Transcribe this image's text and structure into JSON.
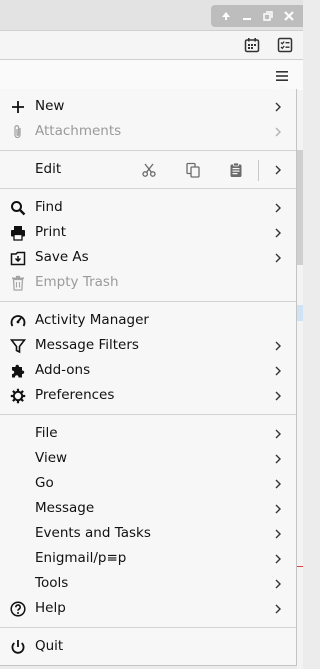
{
  "menu": {
    "items": [
      {
        "label": "New",
        "icon": "plus-icon",
        "submenu": true,
        "disabled": false
      },
      {
        "label": "Attachments",
        "icon": "paperclip-icon",
        "submenu": true,
        "disabled": true
      },
      {
        "label": "Edit",
        "icon": "",
        "submenu": true,
        "disabled": false
      },
      {
        "label": "Find",
        "icon": "magnifier-icon",
        "submenu": true,
        "disabled": false
      },
      {
        "label": "Print",
        "icon": "printer-icon",
        "submenu": true,
        "disabled": false
      },
      {
        "label": "Save As",
        "icon": "save-as-icon",
        "submenu": true,
        "disabled": false
      },
      {
        "label": "Empty Trash",
        "icon": "trash-icon",
        "submenu": false,
        "disabled": true
      },
      {
        "label": "Activity Manager",
        "icon": "gauge-icon",
        "submenu": false,
        "disabled": false
      },
      {
        "label": "Message Filters",
        "icon": "filter-icon",
        "submenu": true,
        "disabled": false
      },
      {
        "label": "Add-ons",
        "icon": "puzzle-icon",
        "submenu": true,
        "disabled": false
      },
      {
        "label": "Preferences",
        "icon": "gear-icon",
        "submenu": true,
        "disabled": false
      },
      {
        "label": "File",
        "icon": "",
        "submenu": true,
        "disabled": false
      },
      {
        "label": "View",
        "icon": "",
        "submenu": true,
        "disabled": false
      },
      {
        "label": "Go",
        "icon": "",
        "submenu": true,
        "disabled": false
      },
      {
        "label": "Message",
        "icon": "",
        "submenu": true,
        "disabled": false
      },
      {
        "label": "Events and Tasks",
        "icon": "",
        "submenu": true,
        "disabled": false
      },
      {
        "label": "Enigmail/p≡p",
        "icon": "",
        "submenu": true,
        "disabled": false
      },
      {
        "label": "Tools",
        "icon": "",
        "submenu": true,
        "disabled": false
      },
      {
        "label": "Help",
        "icon": "help-icon",
        "submenu": true,
        "disabled": false
      },
      {
        "label": "Quit",
        "icon": "power-icon",
        "submenu": false,
        "disabled": false
      }
    ]
  },
  "edit_actions": [
    "cut-icon",
    "copy-icon",
    "paste-icon"
  ],
  "toolbar_icons": [
    "calendar-icon",
    "tasks-icon",
    "hamburger-menu-icon"
  ],
  "window_controls": [
    "scroll-up-icon",
    "minimize-icon",
    "restore-icon",
    "close-icon"
  ]
}
